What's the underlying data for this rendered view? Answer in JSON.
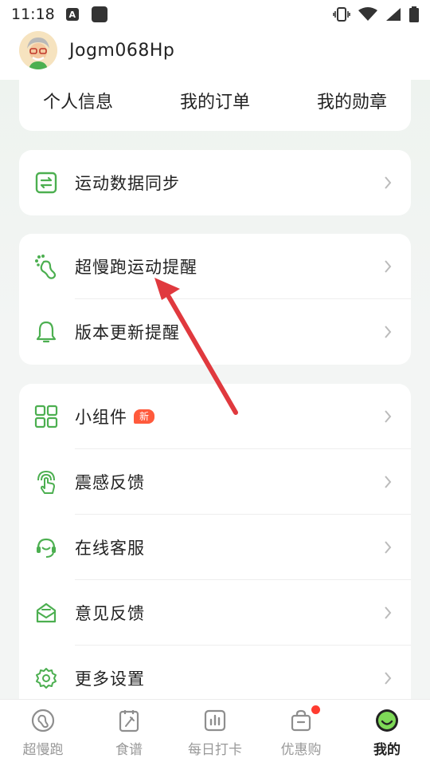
{
  "status_bar": {
    "time": "11:18",
    "a_badge": "A"
  },
  "user": {
    "name": "Jogm068Hp"
  },
  "top_tabs": [
    "个人信息",
    "我的订单",
    "我的勋章"
  ],
  "sync_card": {
    "label": "运动数据同步"
  },
  "reminder_card": {
    "items": [
      {
        "label": "超慢跑运动提醒",
        "icon": "footprint-icon"
      },
      {
        "label": "版本更新提醒",
        "icon": "bell-icon"
      }
    ]
  },
  "settings_card": {
    "items": [
      {
        "label": "小组件",
        "icon": "widget-grid-icon",
        "badge": "新"
      },
      {
        "label": "震感反馈",
        "icon": "vibration-touch-icon"
      },
      {
        "label": "在线客服",
        "icon": "headset-icon"
      },
      {
        "label": "意见反馈",
        "icon": "feedback-mail-icon"
      },
      {
        "label": "更多设置",
        "icon": "gear-icon"
      }
    ]
  },
  "bottom_nav": [
    {
      "label": "超慢跑",
      "icon": "run-footprint-icon",
      "active": false
    },
    {
      "label": "食谱",
      "icon": "recipe-icon",
      "active": false
    },
    {
      "label": "每日打卡",
      "icon": "checkin-chart-icon",
      "active": false
    },
    {
      "label": "优惠购",
      "icon": "shopping-bag-icon",
      "active": false,
      "dot": true
    },
    {
      "label": "我的",
      "icon": "smiley-face-icon",
      "active": true
    }
  ],
  "colors": {
    "accent_green": "#4caf50",
    "badge_red": "#ff5a3c",
    "arrow_red": "#e0393e"
  }
}
